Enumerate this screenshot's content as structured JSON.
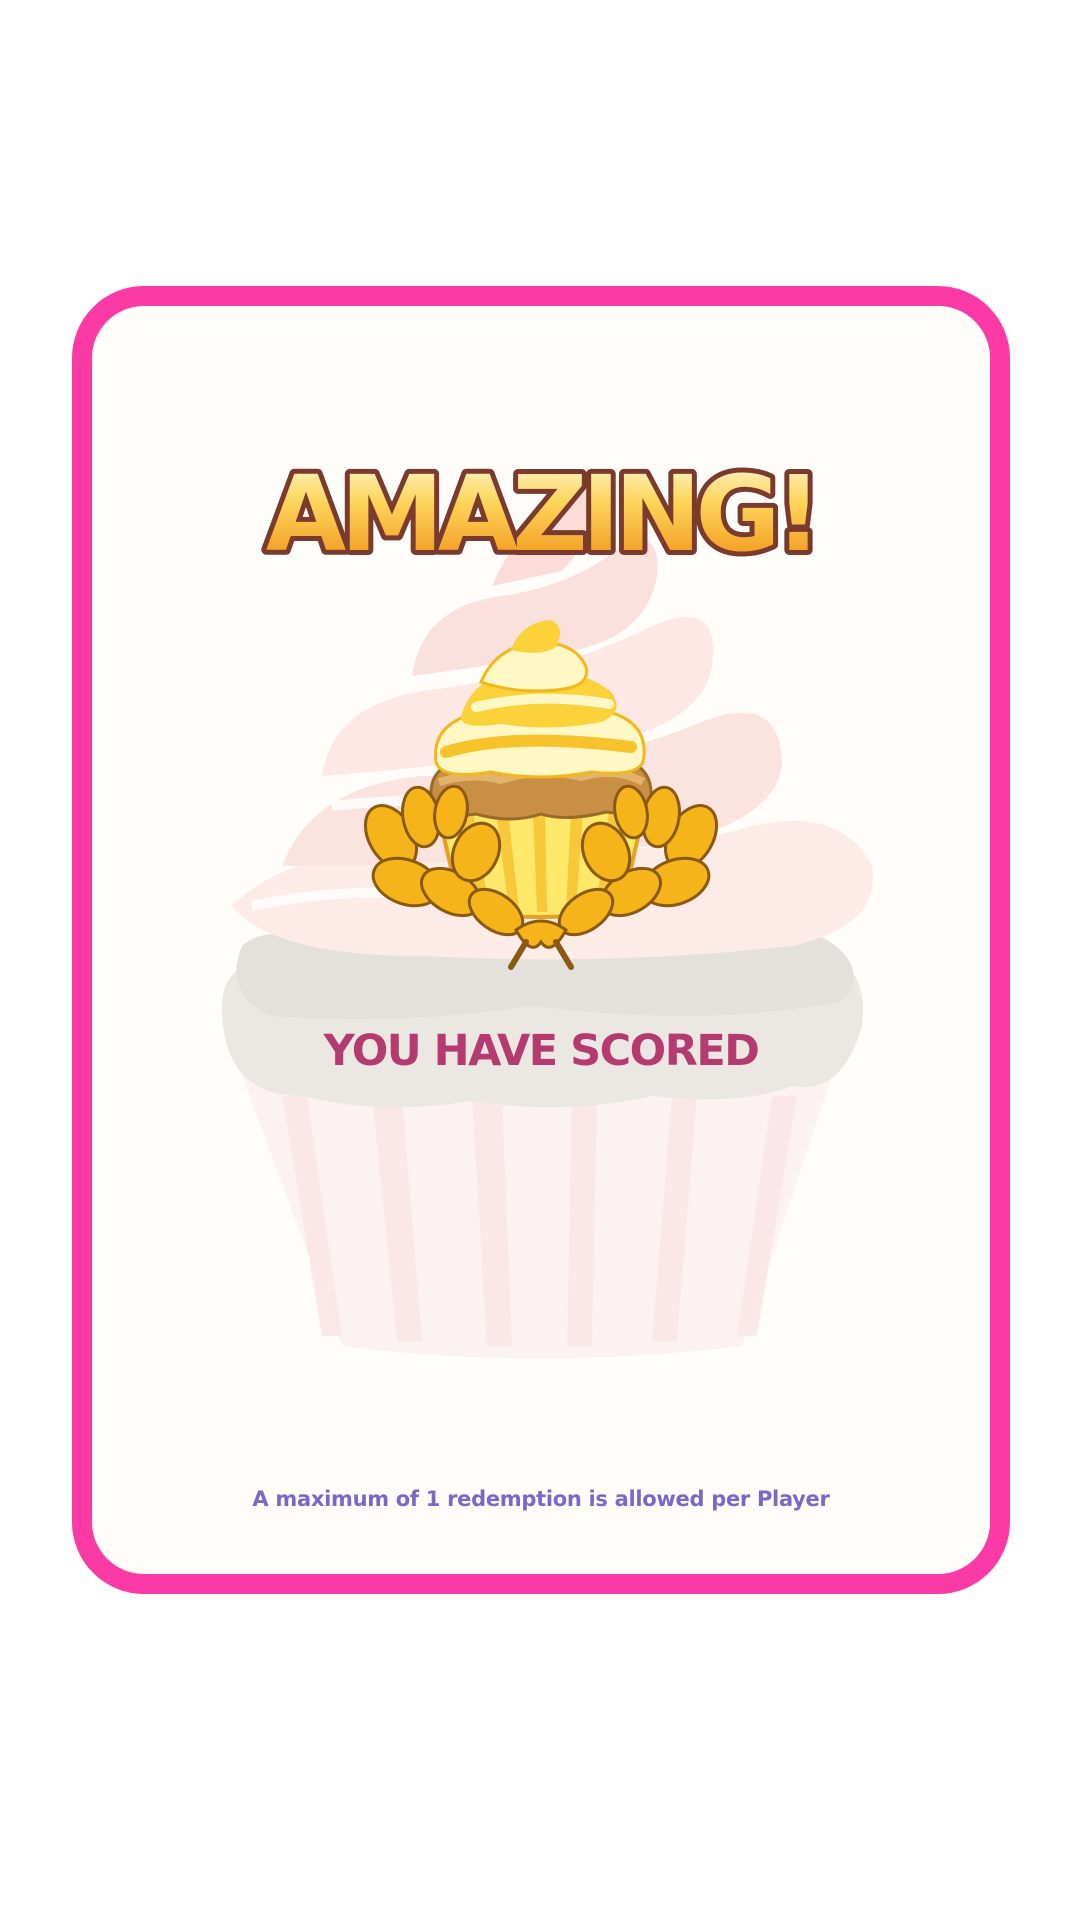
{
  "card": {
    "title": "AMAZING!",
    "subtitle": "YOU HAVE SCORED",
    "note": "A maximum of 1 redemption is allowed per Player"
  },
  "icons": {
    "background": "cupcake-watermark-icon",
    "trophy": "cupcake-laurel-icon"
  },
  "colors": {
    "border": "#fb3aa5",
    "card_background": "#fffdfa",
    "subtitle": "#b53a70",
    "note": "#7a68c9",
    "title_fill_top": "#fff3b0",
    "title_fill_bottom": "#f39a12",
    "title_outline": "#7a3b2e"
  }
}
